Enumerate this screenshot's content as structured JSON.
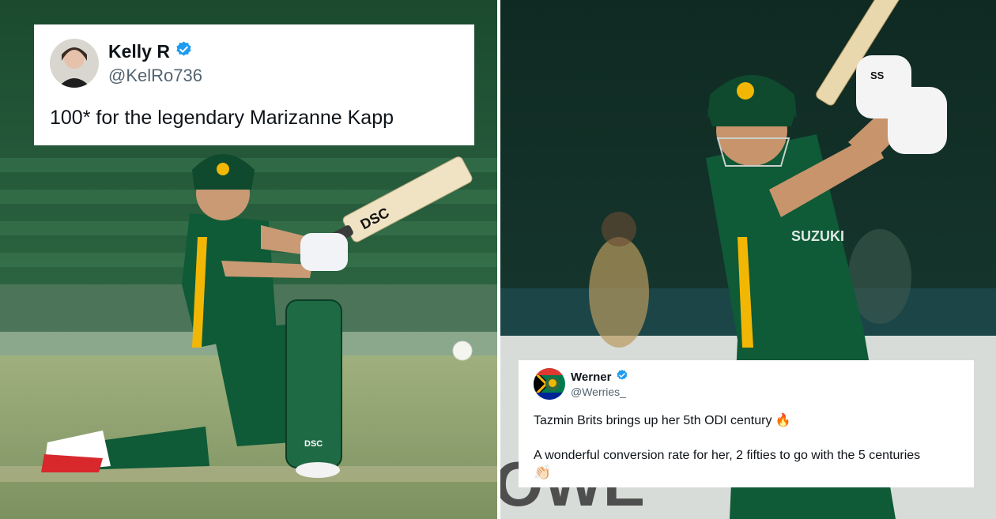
{
  "tweets": [
    {
      "display_name": "Kelly R",
      "handle": "@KelRo736",
      "text": "100* for the legendary Marizanne Kapp",
      "verified": true
    },
    {
      "display_name": "Werner",
      "handle": "@Werries_",
      "text_line1": "Tazmin Brits brings up her 5th ODI century 🔥",
      "text_line2": "A wonderful conversion rate for her, 2 fifties to go with the 5 centuries",
      "text_line3": "👏🏻",
      "verified": true
    }
  ],
  "photos": {
    "left_bat_brand": "DSC",
    "left_pad_brand": "DSC",
    "right_glove_brand": "SS",
    "right_jersey_sponsor": "SUZUKI"
  },
  "colors": {
    "verified_blue": "#1d9bf0",
    "jersey_green": "#0f5a37",
    "jersey_gold": "#f2b705",
    "pitch_green": "#8aa16a"
  }
}
